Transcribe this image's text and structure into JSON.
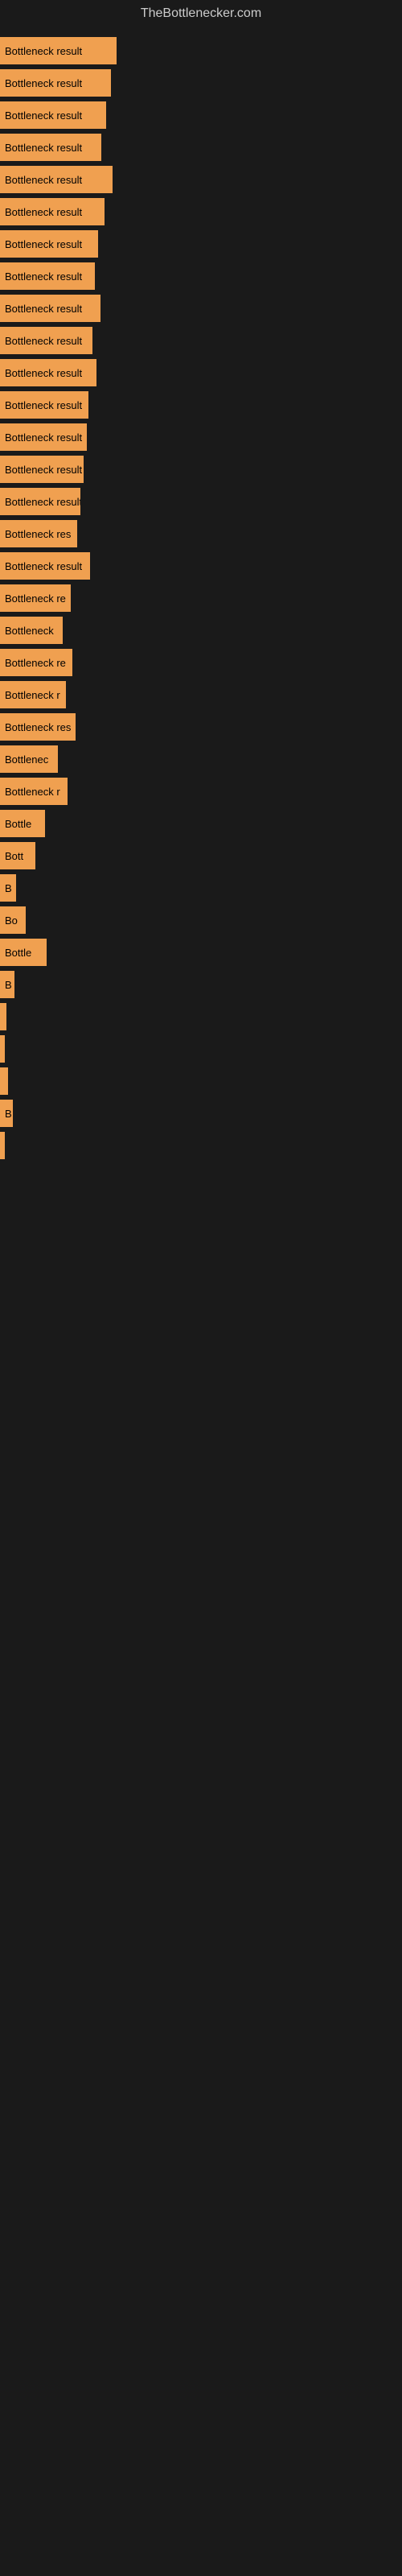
{
  "site_title": "TheBottlenecker.com",
  "bars": [
    {
      "label": "Bottleneck result",
      "width": 145
    },
    {
      "label": "Bottleneck result",
      "width": 138
    },
    {
      "label": "Bottleneck result",
      "width": 132
    },
    {
      "label": "Bottleneck result",
      "width": 126
    },
    {
      "label": "Bottleneck result",
      "width": 140
    },
    {
      "label": "Bottleneck result",
      "width": 130
    },
    {
      "label": "Bottleneck result",
      "width": 122
    },
    {
      "label": "Bottleneck result",
      "width": 118
    },
    {
      "label": "Bottleneck result",
      "width": 125
    },
    {
      "label": "Bottleneck result",
      "width": 115
    },
    {
      "label": "Bottleneck result",
      "width": 120
    },
    {
      "label": "Bottleneck result",
      "width": 110
    },
    {
      "label": "Bottleneck result",
      "width": 108
    },
    {
      "label": "Bottleneck result",
      "width": 104
    },
    {
      "label": "Bottleneck result",
      "width": 100
    },
    {
      "label": "Bottleneck res",
      "width": 96
    },
    {
      "label": "Bottleneck result",
      "width": 112
    },
    {
      "label": "Bottleneck re",
      "width": 88
    },
    {
      "label": "Bottleneck",
      "width": 78
    },
    {
      "label": "Bottleneck re",
      "width": 90
    },
    {
      "label": "Bottleneck r",
      "width": 82
    },
    {
      "label": "Bottleneck res",
      "width": 94
    },
    {
      "label": "Bottlenec",
      "width": 72
    },
    {
      "label": "Bottleneck r",
      "width": 84
    },
    {
      "label": "Bottle",
      "width": 56
    },
    {
      "label": "Bott",
      "width": 44
    },
    {
      "label": "B",
      "width": 20
    },
    {
      "label": "Bo",
      "width": 32
    },
    {
      "label": "Bottle",
      "width": 58
    },
    {
      "label": "B",
      "width": 18
    },
    {
      "label": "",
      "width": 8
    },
    {
      "label": "",
      "width": 6
    },
    {
      "label": "",
      "width": 10
    },
    {
      "label": "B",
      "width": 16
    },
    {
      "label": "",
      "width": 6
    }
  ]
}
